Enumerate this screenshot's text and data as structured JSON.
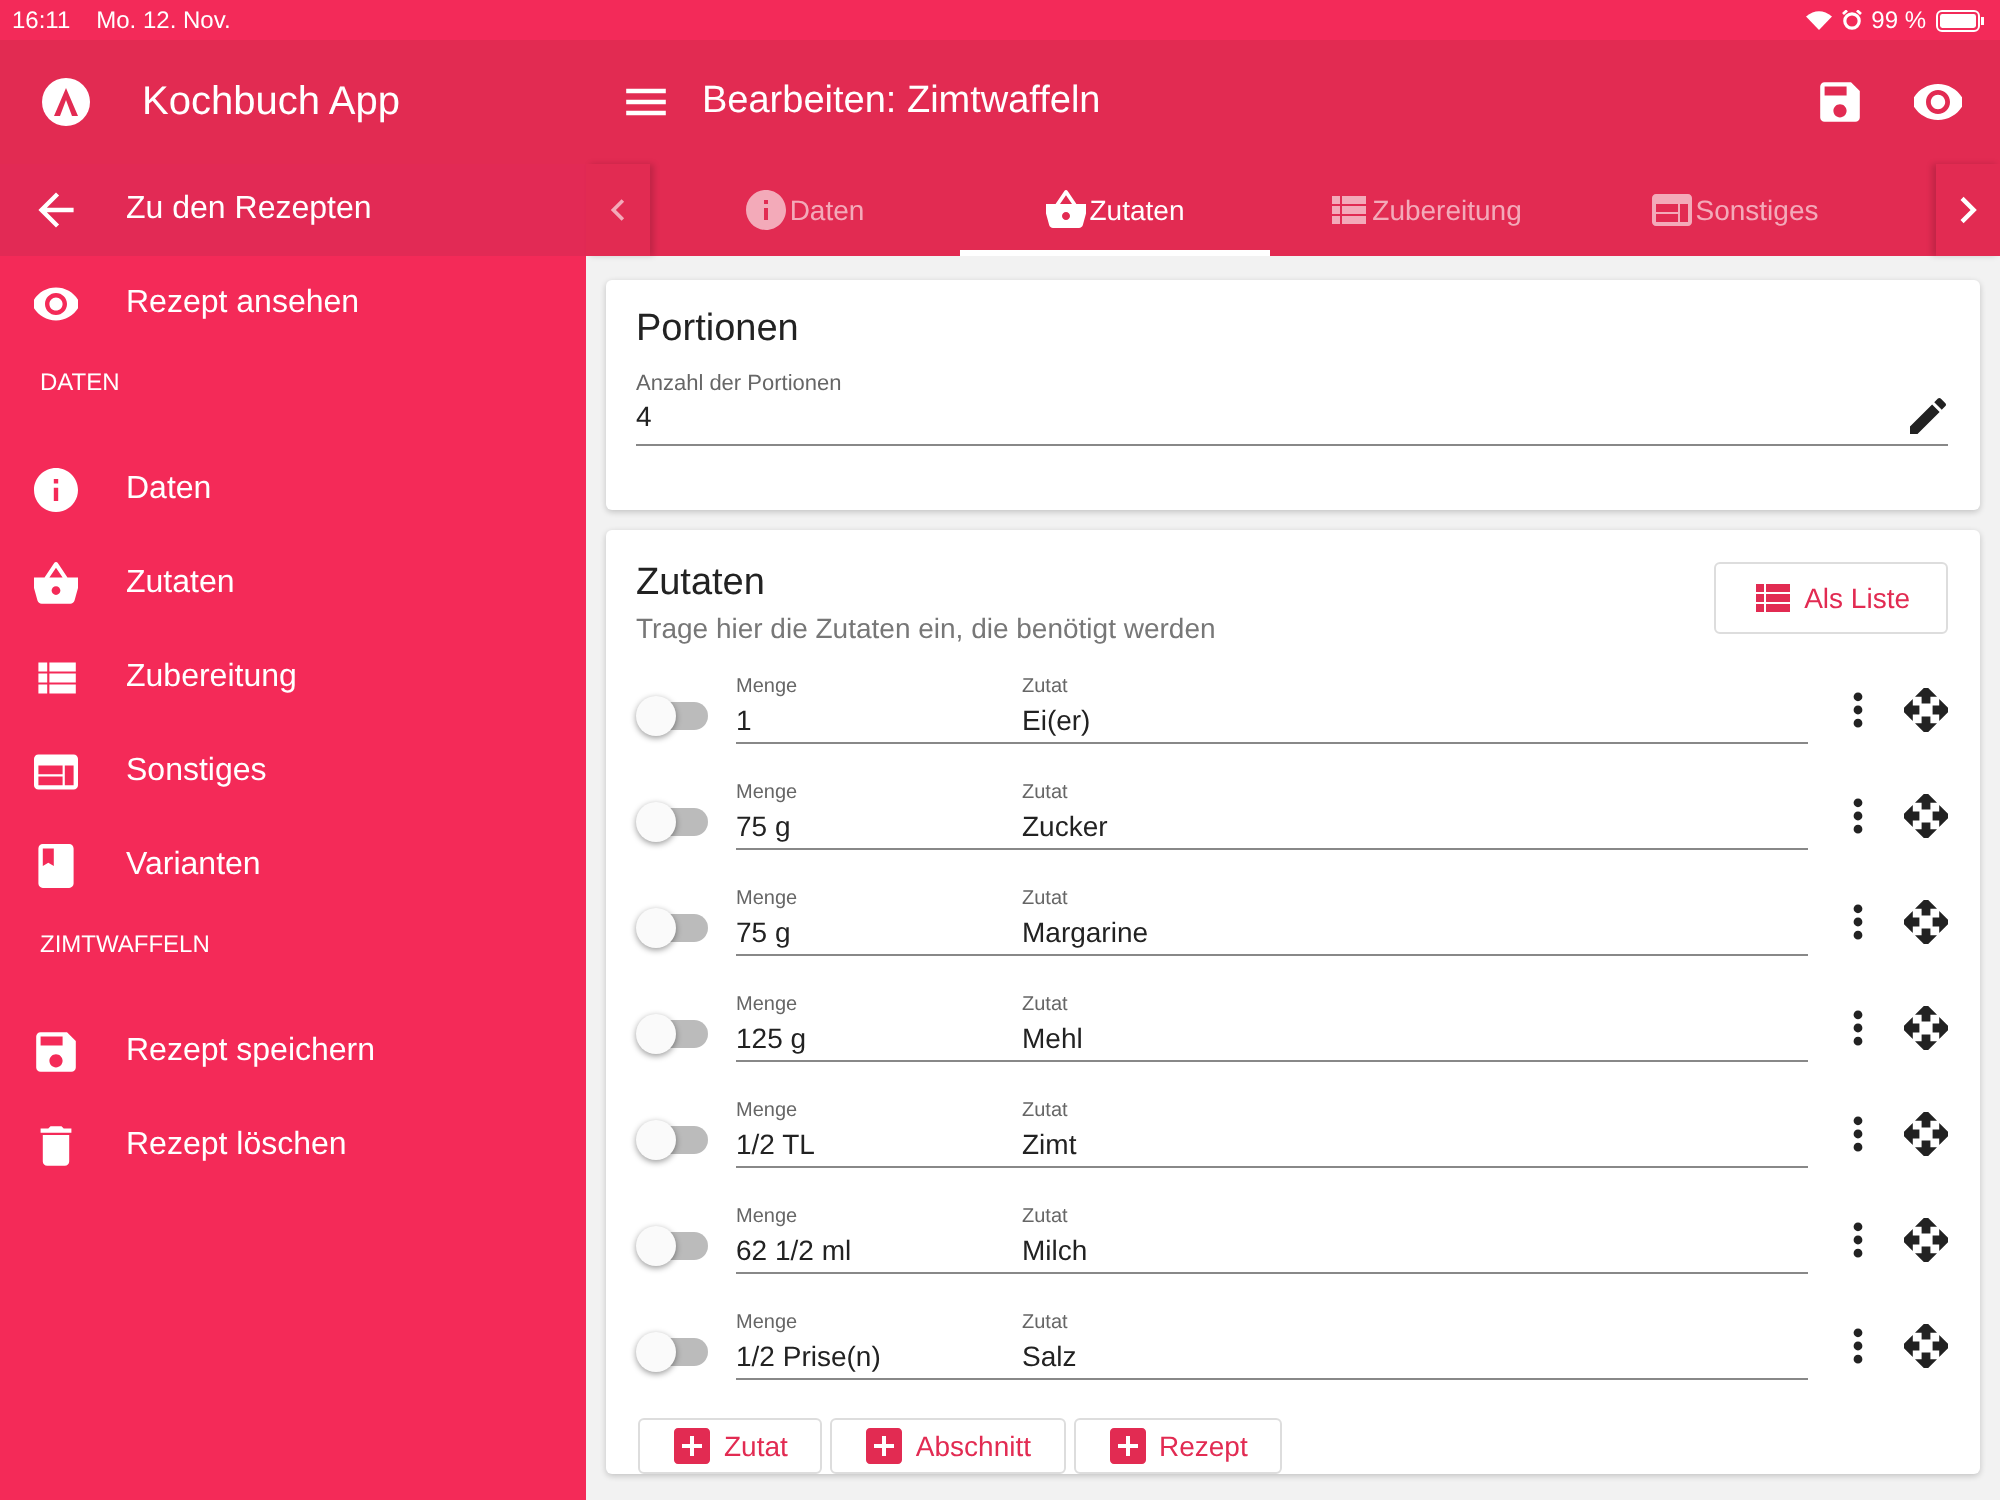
{
  "status_bar": {
    "time": "16:11",
    "date": "Mo. 12. Nov.",
    "battery": "99 %"
  },
  "sidebar": {
    "app_title": "Kochbuch App",
    "items": [
      {
        "kind": "back",
        "label": "Zu den Rezepten"
      },
      {
        "kind": "view",
        "label": "Rezept ansehen"
      },
      {
        "kind": "section",
        "label": "DATEN"
      },
      {
        "kind": "info",
        "label": "Daten"
      },
      {
        "kind": "basket",
        "label": "Zutaten"
      },
      {
        "kind": "list",
        "label": "Zubereitung"
      },
      {
        "kind": "panel",
        "label": "Sonstiges"
      },
      {
        "kind": "book",
        "label": "Varianten"
      },
      {
        "kind": "section",
        "label": "ZIMTWAFFELN"
      },
      {
        "kind": "save",
        "label": "Rezept speichern"
      },
      {
        "kind": "delete",
        "label": "Rezept löschen"
      }
    ]
  },
  "header": {
    "title": "Bearbeiten: Zimtwaffeln"
  },
  "tabs": [
    {
      "kind": "info",
      "label": "Daten",
      "selected": false
    },
    {
      "kind": "basket",
      "label": "Zutaten",
      "selected": true
    },
    {
      "kind": "list",
      "label": "Zubereitung",
      "selected": false
    },
    {
      "kind": "panel",
      "label": "Sonstiges",
      "selected": false
    }
  ],
  "portions": {
    "title": "Portionen",
    "field_label": "Anzahl der Portionen",
    "value": "4"
  },
  "ingredients": {
    "title": "Zutaten",
    "subtitle": "Trage hier die Zutaten ein, die benötigt werden",
    "list_button": "Als Liste",
    "rows": [
      {
        "checked": false,
        "amount_label": "Menge",
        "amount": "1",
        "ingredient_label": "Zutat",
        "ingredient": "Ei(er)"
      },
      {
        "checked": false,
        "amount_label": "Menge",
        "amount": "75 g",
        "ingredient_label": "Zutat",
        "ingredient": "Zucker"
      },
      {
        "checked": false,
        "amount_label": "Menge",
        "amount": "75 g",
        "ingredient_label": "Zutat",
        "ingredient": "Margarine"
      },
      {
        "checked": false,
        "amount_label": "Menge",
        "amount": "125 g",
        "ingredient_label": "Zutat",
        "ingredient": "Mehl"
      },
      {
        "checked": false,
        "amount_label": "Menge",
        "amount": "1/2 TL",
        "ingredient_label": "Zutat",
        "ingredient": "Zimt"
      },
      {
        "checked": false,
        "amount_label": "Menge",
        "amount": "62 1/2 ml",
        "ingredient_label": "Zutat",
        "ingredient": "Milch"
      },
      {
        "checked": false,
        "amount_label": "Menge",
        "amount": "1/2 Prise(n)",
        "ingredient_label": "Zutat",
        "ingredient": "Salz"
      }
    ],
    "add_buttons": [
      "Zutat",
      "Abschnitt",
      "Rezept"
    ]
  }
}
